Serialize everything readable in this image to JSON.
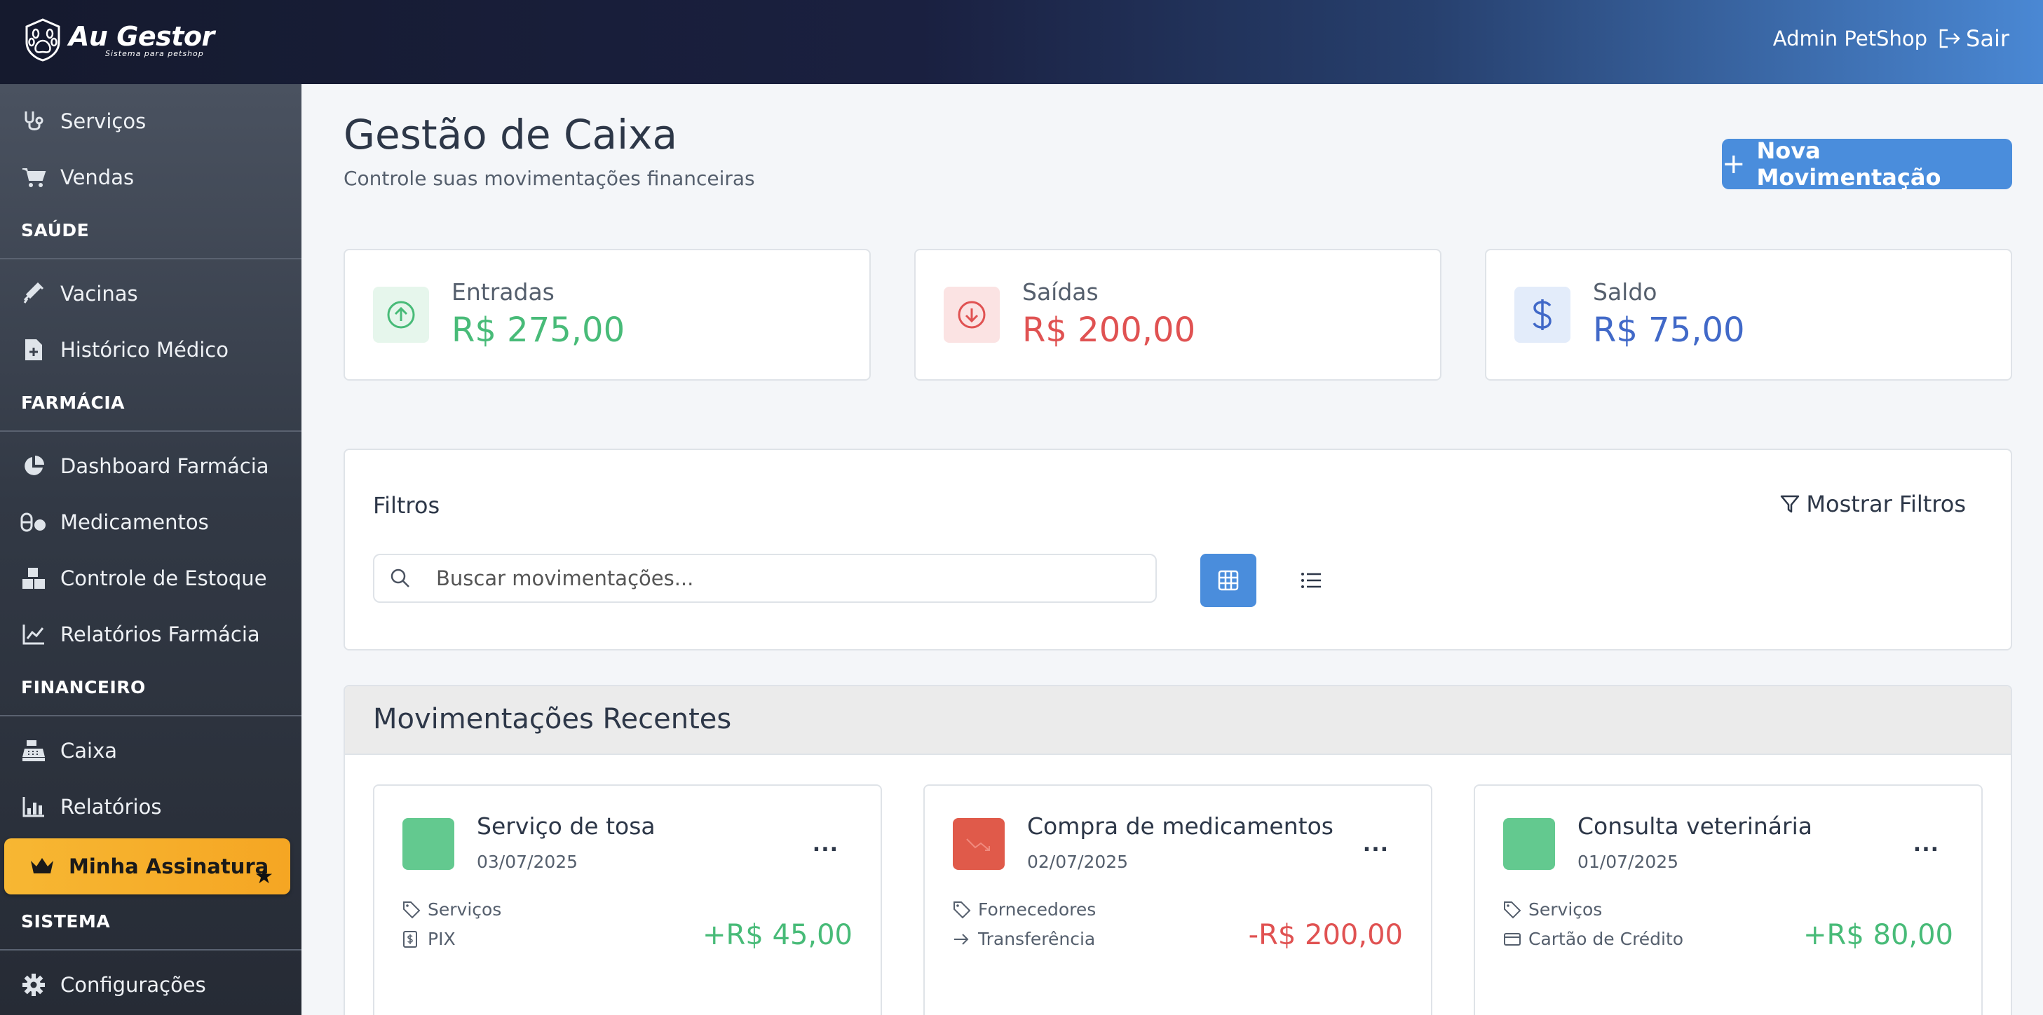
{
  "header": {
    "logo_title": "Au Gestor",
    "logo_subtitle": "Sistema para petshop",
    "user_name": "Admin PetShop",
    "logout_label": "Sair"
  },
  "sidebar": {
    "items_top": [
      {
        "label": "Serviços",
        "icon": "stethoscope-icon"
      },
      {
        "label": "Vendas",
        "icon": "cart-icon"
      }
    ],
    "sections": [
      {
        "title": "SAÚDE",
        "items": [
          {
            "label": "Vacinas",
            "icon": "syringe-icon"
          },
          {
            "label": "Histórico Médico",
            "icon": "medical-file-icon"
          }
        ]
      },
      {
        "title": "FARMÁCIA",
        "items": [
          {
            "label": "Dashboard Farmácia",
            "icon": "pie-chart-icon"
          },
          {
            "label": "Medicamentos",
            "icon": "pills-icon"
          },
          {
            "label": "Controle de Estoque",
            "icon": "boxes-icon"
          },
          {
            "label": "Relatórios Farmácia",
            "icon": "line-chart-icon"
          }
        ]
      },
      {
        "title": "FINANCEIRO",
        "items": [
          {
            "label": "Caixa",
            "icon": "cash-register-icon"
          },
          {
            "label": "Relatórios",
            "icon": "bar-chart-icon"
          }
        ]
      },
      {
        "title": "SISTEMA",
        "items": [
          {
            "label": "Configurações",
            "icon": "gear-icon"
          }
        ]
      }
    ],
    "subscription_label": "Minha Assinatura",
    "subscription_star": "★"
  },
  "main": {
    "title": "Gestão de Caixa",
    "subtitle": "Controle suas movimentações financeiras",
    "new_button_label": "Nova Movimentação",
    "new_button_plus": "+",
    "stats": [
      {
        "label": "Entradas",
        "value": "R$ 275,00",
        "color": "#48bb78",
        "bg": "#e6f6ec",
        "icon": "arrow-up-circle-icon"
      },
      {
        "label": "Saídas",
        "value": "R$ 200,00",
        "color": "#e05252",
        "bg": "#fbe3e3",
        "icon": "arrow-down-circle-icon"
      },
      {
        "label": "Saldo",
        "value": "R$ 75,00",
        "color": "#4169c8",
        "bg": "#e3ecfa",
        "icon": "dollar-icon"
      }
    ],
    "filters": {
      "title": "Filtros",
      "toggle_label": "Mostrar Filtros",
      "search_placeholder": "Buscar movimentações..."
    },
    "recent": {
      "title": "Movimentações Recentes",
      "items": [
        {
          "title": "Serviço de tosa",
          "date": "03/07/2025",
          "category": "Serviços",
          "method": "PIX",
          "method_icon": "receipt-icon",
          "amount": "+R$ 45,00",
          "type": "entrada",
          "color": "#48bb78",
          "icon_bg": "#63c98f"
        },
        {
          "title": "Compra de medicamentos",
          "date": "02/07/2025",
          "category": "Fornecedores",
          "method": "Transferência",
          "method_icon": "arrow-right-icon",
          "amount": "-R$ 200,00",
          "type": "saida",
          "color": "#e05252",
          "icon_bg": "#e05a4a"
        },
        {
          "title": "Consulta veterinária",
          "date": "01/07/2025",
          "category": "Serviços",
          "method": "Cartão de Crédito",
          "method_icon": "credit-card-icon",
          "amount": "+R$ 80,00",
          "type": "entrada",
          "color": "#48bb78",
          "icon_bg": "#63c98f"
        }
      ],
      "menu_label": "..."
    }
  }
}
